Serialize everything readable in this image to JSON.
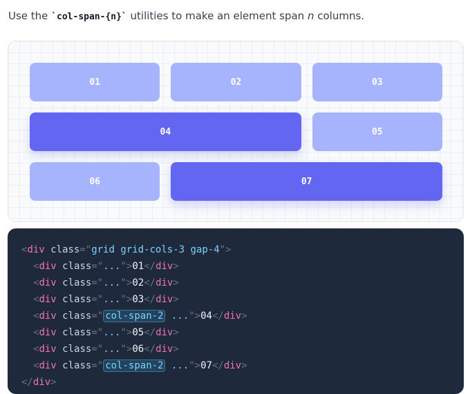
{
  "intro": {
    "before": "Use the ",
    "code": "`col-span-{n}`",
    "middle": " utilities to make an element span ",
    "em": "n",
    "after": " columns."
  },
  "grid_cells": [
    {
      "label": "01",
      "span": 1
    },
    {
      "label": "02",
      "span": 1
    },
    {
      "label": "03",
      "span": 1
    },
    {
      "label": "04",
      "span": 2
    },
    {
      "label": "05",
      "span": 1
    },
    {
      "label": "06",
      "span": 1
    },
    {
      "label": "07",
      "span": 2
    }
  ],
  "code": {
    "open_tag": "div",
    "attr": "class",
    "outer_class": "grid grid-cols-3 gap-4",
    "placeholder": "...",
    "span_class": "col-span-2",
    "lines": [
      {
        "label": "01",
        "highlight": ""
      },
      {
        "label": "02",
        "highlight": ""
      },
      {
        "label": "03",
        "highlight": ""
      },
      {
        "label": "04",
        "highlight": "col-span-2"
      },
      {
        "label": "05",
        "highlight": ""
      },
      {
        "label": "06",
        "highlight": ""
      },
      {
        "label": "07",
        "highlight": "col-span-2"
      }
    ]
  },
  "colors": {
    "cell_light": "#a5b4fc",
    "cell_dark": "#6366f1",
    "code_bg": "#1e293b",
    "tag_pink": "#f472b6",
    "string_blue": "#7dd3fc"
  }
}
